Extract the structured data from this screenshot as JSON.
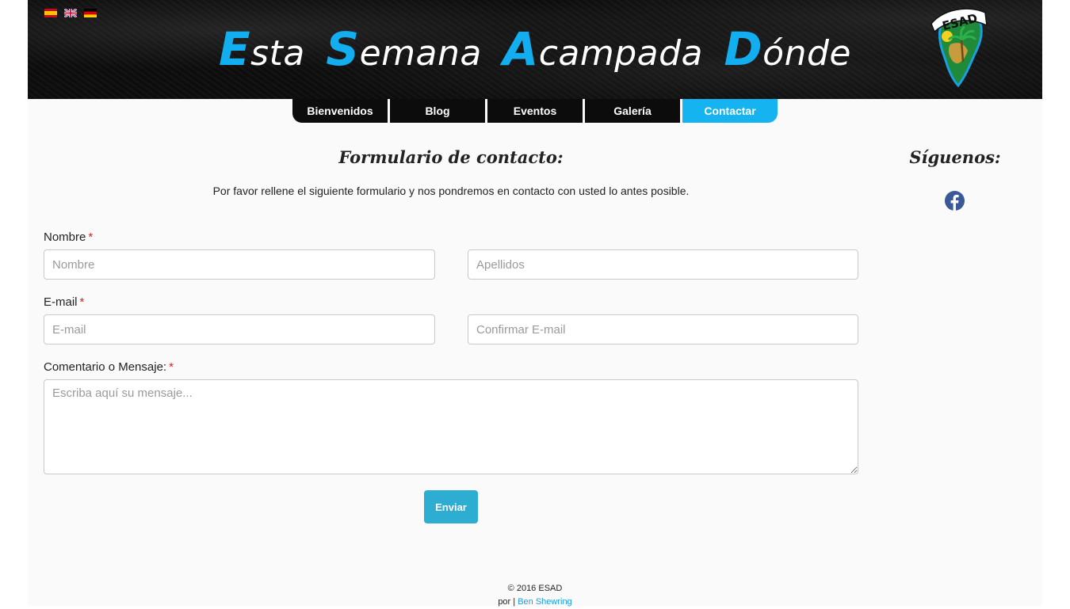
{
  "header": {
    "languages": [
      {
        "name": "Español",
        "icon": "spain-flag-icon"
      },
      {
        "name": "English",
        "icon": "uk-flag-icon"
      },
      {
        "name": "Deutsch",
        "icon": "germany-flag-icon"
      }
    ],
    "title_words": [
      {
        "cap": "E",
        "rest": "sta"
      },
      {
        "cap": "S",
        "rest": "emana"
      },
      {
        "cap": "A",
        "rest": "campada"
      },
      {
        "cap": "D",
        "rest": "ónde"
      }
    ],
    "logo_text": "ESAD",
    "accent_color": "#12aef0"
  },
  "nav": {
    "items": [
      {
        "label": "Bienvenidos"
      },
      {
        "label": "Blog"
      },
      {
        "label": "Eventos"
      },
      {
        "label": "Galería"
      },
      {
        "label": "Contactar"
      }
    ],
    "active_index": 4,
    "active_color": "#15b4f0"
  },
  "form": {
    "title": "Formulario de contacto:",
    "intro": "Por favor rellene el siguiente formulario y nos pondremos en contacto con usted lo antes posible.",
    "name_label": "Nombre",
    "required_mark": "*",
    "first_name_placeholder": "Nombre",
    "last_name_placeholder": "Apellidos",
    "email_label": "E-mail",
    "email_placeholder": "E-mail",
    "confirm_email_placeholder": "Confirmar E-mail",
    "message_label": "Comentario o Mensaje:",
    "message_placeholder": "Escriba aquí su mensaje...",
    "submit_label": "Enviar",
    "submit_color": "#2eadd3"
  },
  "sidebar": {
    "title": "Síguenos:",
    "social_icon": "facebook-icon"
  },
  "footer": {
    "copyright": "© 2016 ESAD",
    "by_prefix": "por |",
    "author": "Ben Shewring"
  }
}
